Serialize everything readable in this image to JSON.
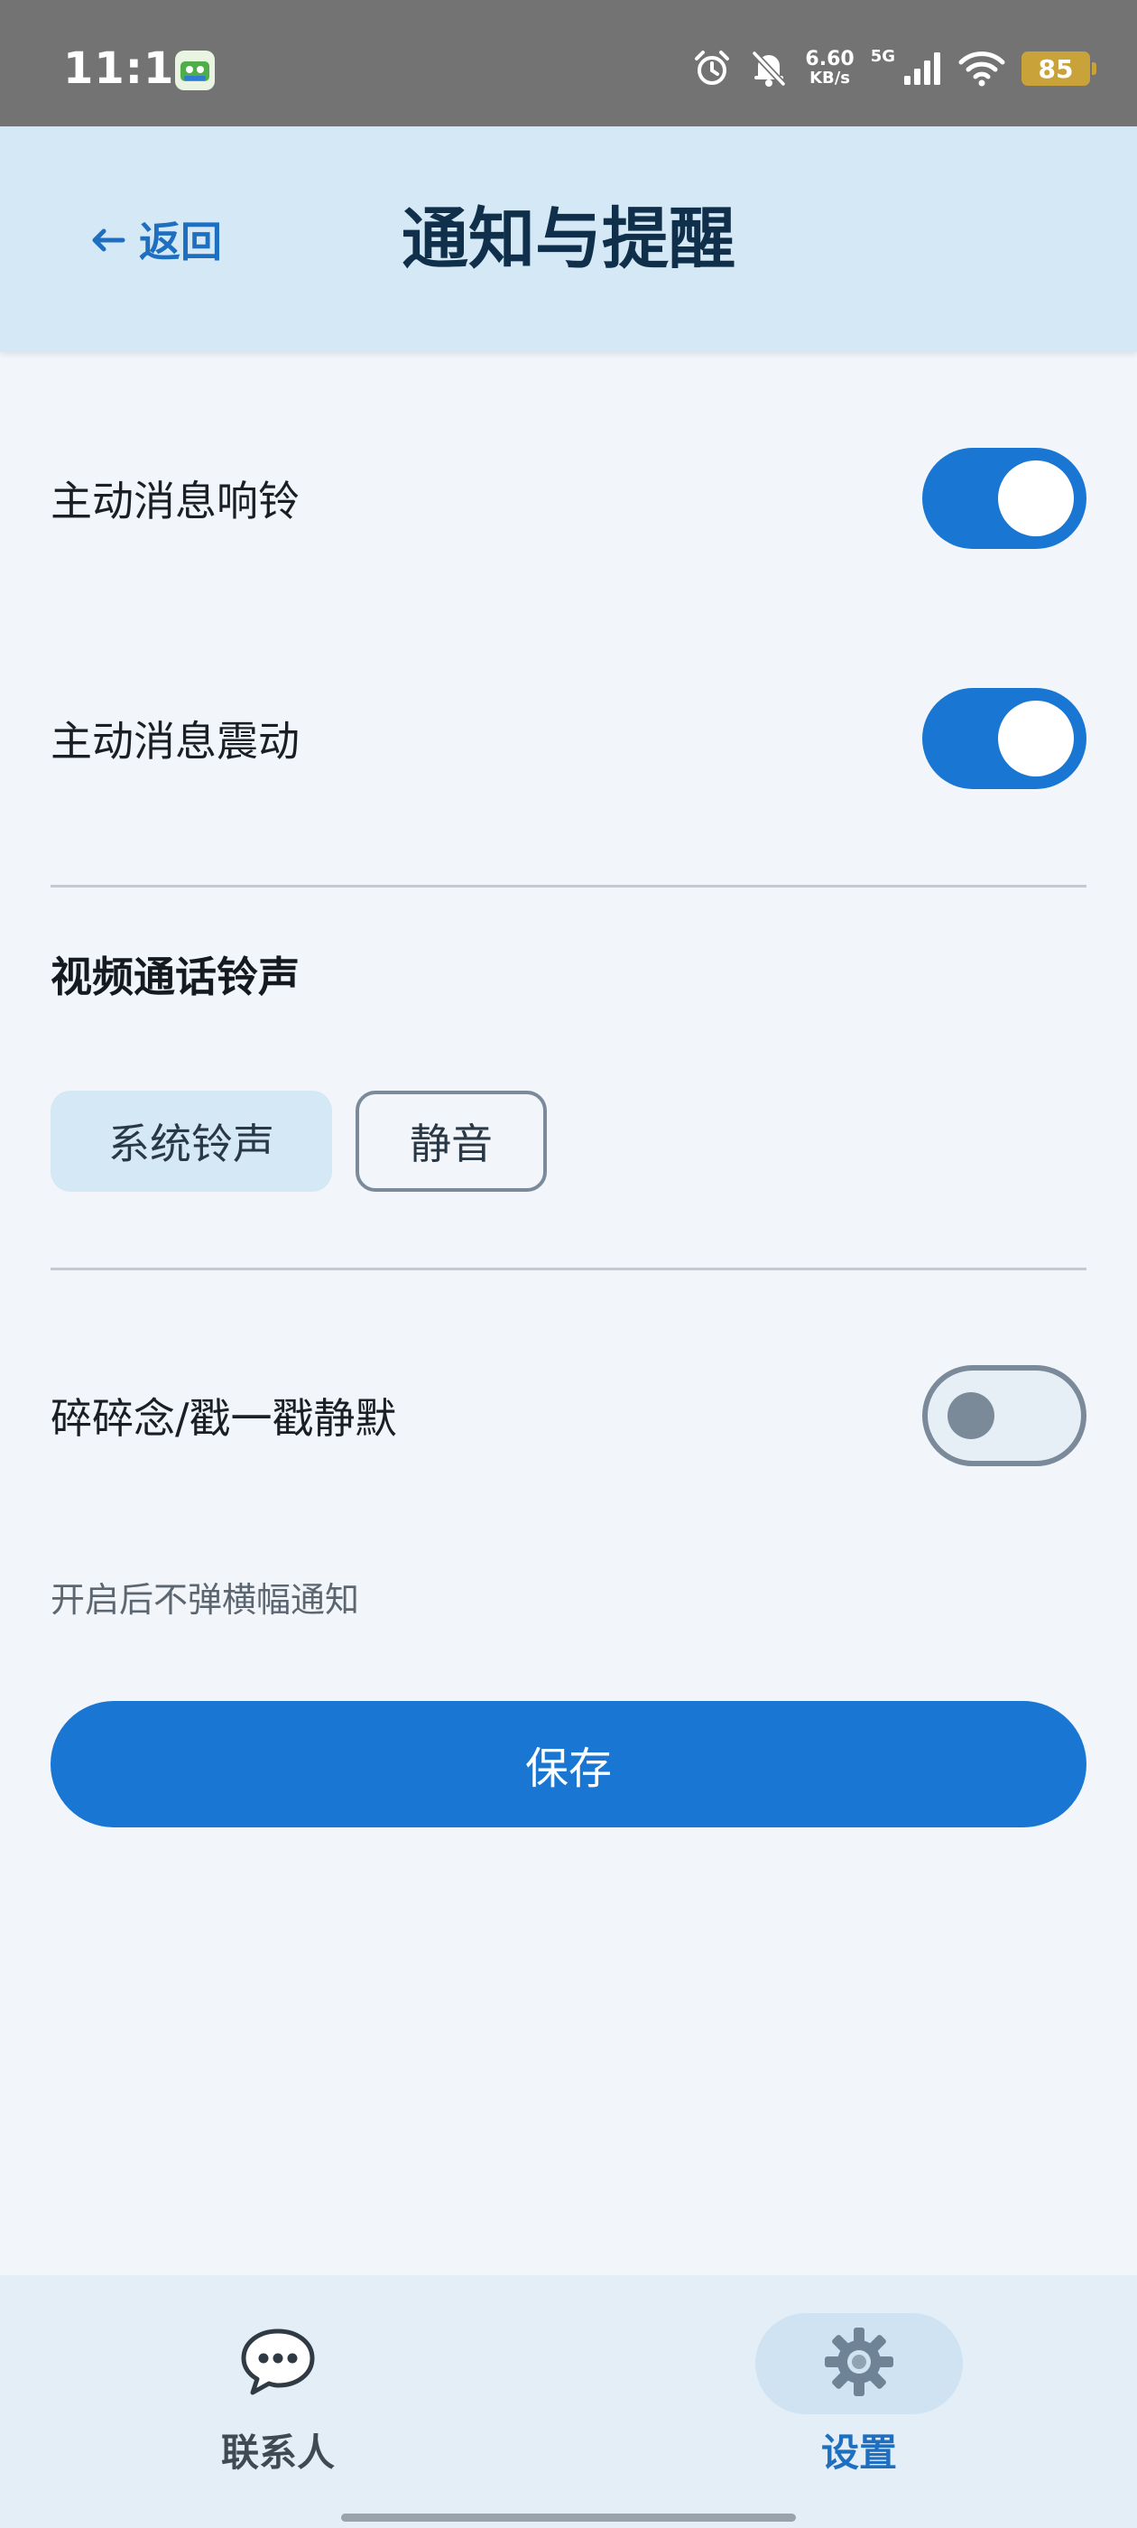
{
  "status_bar": {
    "time": "11:14",
    "net_speed": "6.60",
    "net_unit": "KB/s",
    "signal_label": "5G",
    "battery": "85"
  },
  "header": {
    "back_label": "返回",
    "title": "通知与提醒"
  },
  "settings": {
    "ring": {
      "label": "主动消息响铃",
      "on": true
    },
    "vibrate": {
      "label": "主动消息震动",
      "on": true
    },
    "ringtone_section": "视频通话铃声",
    "ringtone_options": [
      "系统铃声",
      "静音"
    ],
    "selected_ringtone": "系统铃声",
    "mute_chatter": {
      "label": "碎碎念/戳一戳静默",
      "on": false
    },
    "mute_hint": "开启后不弹横幅通知"
  },
  "save_label": "保存",
  "bottom_nav": {
    "contacts": "联系人",
    "settings": "设置",
    "active": "settings"
  },
  "colors": {
    "primary": "#1976d2",
    "header_bg": "#d5e8f6",
    "page_bg": "#f2f6fb",
    "status_bar_bg": "#737373"
  }
}
